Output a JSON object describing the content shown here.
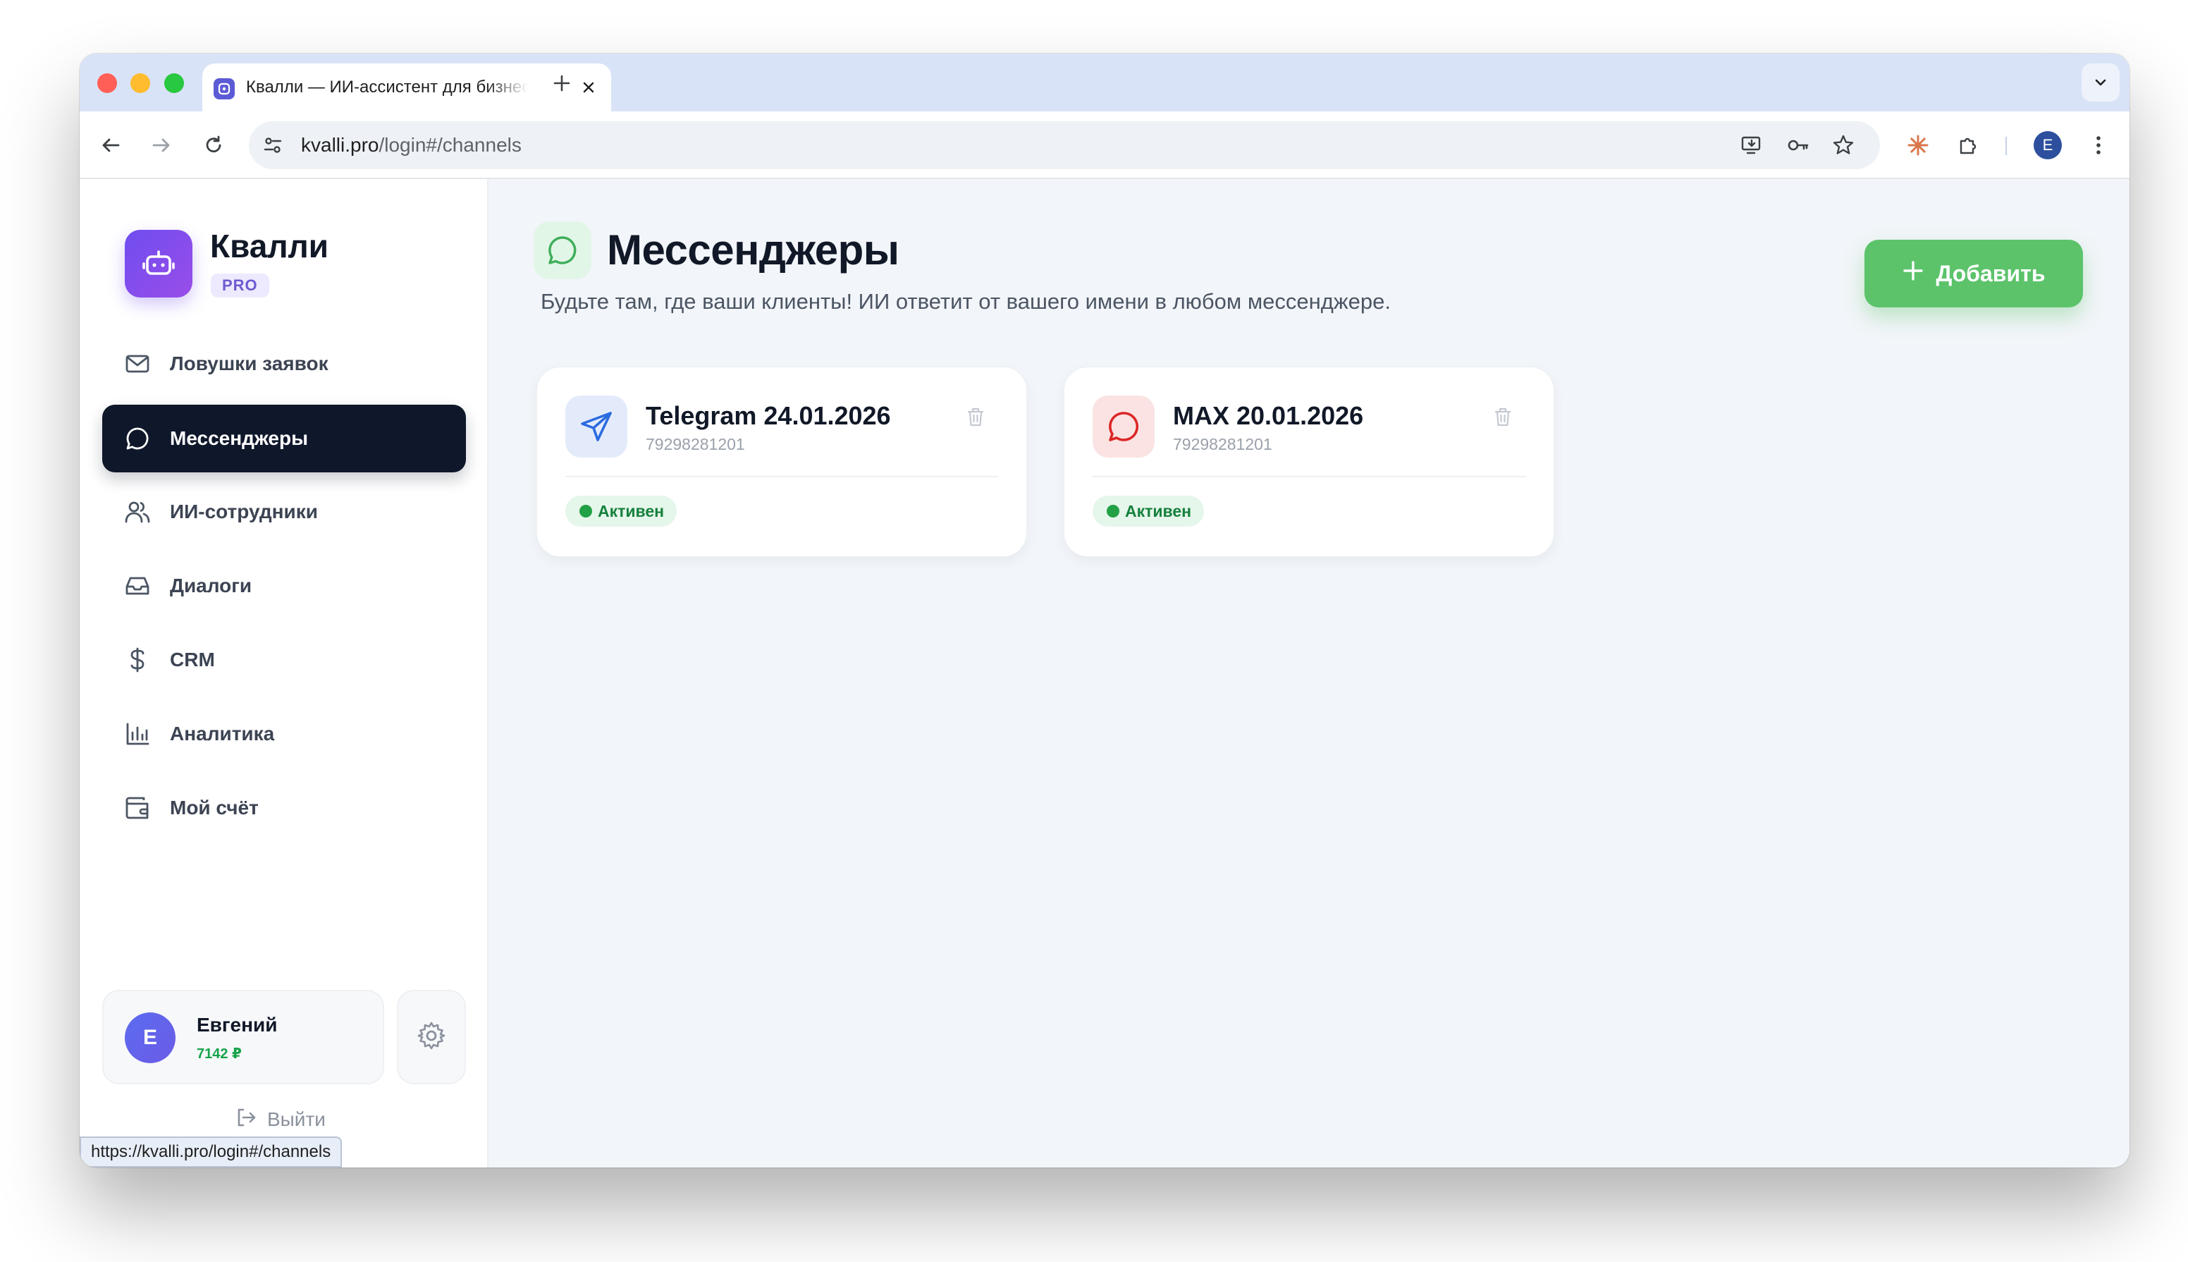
{
  "browser": {
    "tab_title": "Квалли — ИИ-ассистент для бизнеса",
    "url_host": "kvalli.pro",
    "url_path": "/login#/channels",
    "profile_initial": "E",
    "status_url": "https://kvalli.pro/login#/channels"
  },
  "brand": {
    "name": "Квалли",
    "badge": "PRO",
    "accent": "#6f4df0"
  },
  "sidebar": {
    "items": [
      {
        "label": "Ловушки заявок",
        "icon": "mail-icon",
        "active": false
      },
      {
        "label": "Мессенджеры",
        "icon": "chat-bubble-icon",
        "active": true
      },
      {
        "label": "ИИ-сотрудники",
        "icon": "users-icon",
        "active": false
      },
      {
        "label": "Диалоги",
        "icon": "inbox-icon",
        "active": false
      },
      {
        "label": "CRM",
        "icon": "dollar-icon",
        "active": false
      },
      {
        "label": "Аналитика",
        "icon": "bar-chart-icon",
        "active": false
      },
      {
        "label": "Мой счёт",
        "icon": "wallet-icon",
        "active": false
      }
    ],
    "user": {
      "initial": "E",
      "name": "Евгений",
      "balance": "7142 ₽"
    },
    "logout_label": "Выйти"
  },
  "main": {
    "title": "Мессенджеры",
    "subtitle": "Будьте там, где ваши клиенты! ИИ ответит от вашего имени в любом мессенджере.",
    "add_label": "Добавить",
    "add_color": "#5cc36b",
    "channels": [
      {
        "name": "Telegram 24.01.2026",
        "phone": "79298281201",
        "status": "Активен",
        "icon": "telegram-send-icon",
        "icon_color": "#2b6be0"
      },
      {
        "name": "MAX 20.01.2026",
        "phone": "79298281201",
        "status": "Активен",
        "icon": "max-chat-icon",
        "icon_color": "#dc2626"
      }
    ]
  }
}
